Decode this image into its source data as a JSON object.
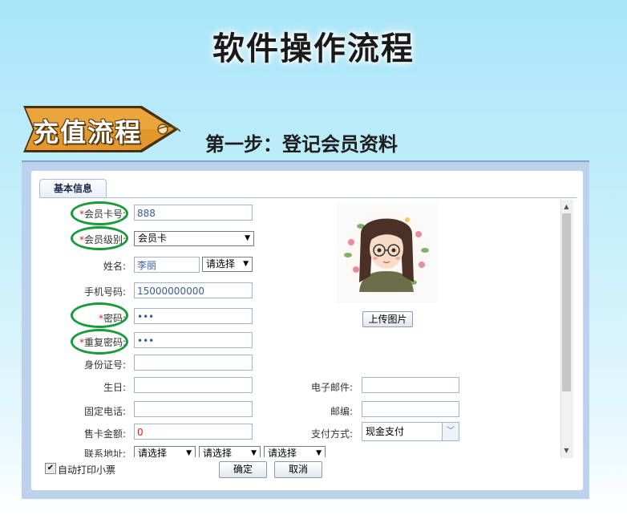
{
  "page_title": "软件操作流程",
  "ribbon_label": "充值流程",
  "step_text": "第一步：登记会员资料",
  "tab_label": "基本信息",
  "form": {
    "card_no": {
      "label": "会员卡号:",
      "required": "*",
      "value": "888"
    },
    "level": {
      "label": "会员级别:",
      "required": "*",
      "value": "会员卡"
    },
    "name": {
      "label": "姓名:",
      "value": "李丽",
      "gender": "请选择"
    },
    "phone": {
      "label": "手机号码:",
      "value": "15000000000"
    },
    "password": {
      "label": "密码:",
      "required": "*",
      "value": "•••"
    },
    "password_confirm": {
      "label": "重复密码:",
      "required": "*",
      "value": "•••"
    },
    "id_no": {
      "label": "身份证号:",
      "value": ""
    },
    "birthday": {
      "label": "生日:",
      "value": ""
    },
    "email": {
      "label": "电子邮件:",
      "value": ""
    },
    "landline": {
      "label": "固定电话:",
      "value": ""
    },
    "postcode": {
      "label": "邮编:",
      "value": ""
    },
    "sale_amount": {
      "label": "售卡金额:",
      "value": "0"
    },
    "pay_method": {
      "label": "支付方式:",
      "value": "现金支付"
    },
    "address": {
      "label": "联系地址:",
      "province": "请选择",
      "city": "请选择",
      "district": "请选择"
    }
  },
  "upload_button": "上传图片",
  "auto_print_label": "自动打印小票",
  "ok_button": "确定",
  "cancel_button": "取消",
  "colors": {
    "highlight_oval": "#1a9a3a",
    "required_mark": "#e02020",
    "ribbon": "#d98b2a"
  }
}
